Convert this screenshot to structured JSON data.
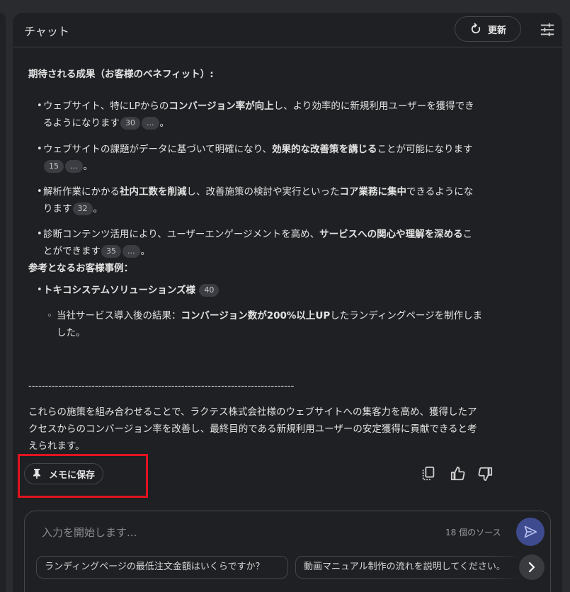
{
  "header": {
    "title": "チャット",
    "refresh_label": "更新"
  },
  "content": {
    "benefits_heading": "期待される成果（お客様のベネフィット）:",
    "bullets": [
      {
        "lines": [
          [
            "ウェブサイト、特にLPからの",
            {
              "b": "コンバージョン率が向上"
            },
            "し、より効率的に新規利用ユーザーを獲得でき"
          ],
          [
            "るようになります",
            {
              "pill": "30"
            },
            {
              "pill": "..."
            },
            "。"
          ]
        ]
      },
      {
        "lines": [
          [
            "ウェブサイトの課題がデータに基づいて明確になり、",
            {
              "b": "効果的な改善策を講じる"
            },
            "ことが可能になります"
          ],
          [
            {
              "pill": "15"
            },
            {
              "pill": "..."
            },
            "。"
          ]
        ]
      },
      {
        "lines": [
          [
            "解析作業にかかる",
            {
              "b": "社内工数を削減"
            },
            "し、改善施策の検討や実行といった",
            {
              "b": "コア業務に集中"
            },
            "できるようにな"
          ],
          [
            "ります",
            {
              "pill": "32"
            },
            "。"
          ]
        ]
      },
      {
        "lines": [
          [
            "診断コンテンツ活用により、ユーザーエンゲージメントを高め、",
            {
              "b": "サービスへの関心や理解を深める"
            },
            "こ"
          ],
          [
            "とができます",
            {
              "pill": "35"
            },
            {
              "pill": "..."
            },
            "。"
          ]
        ]
      }
    ],
    "case_heading": "参考となるお客様事例：",
    "case_company": "トキコシステムソリューションズ様",
    "case_company_pill": "40",
    "case_result_lines": [
      [
        "当社サービス導入後の結果：",
        {
          "b": "コンバージョン数が200%以上UP"
        },
        "したランディングページを制作しま"
      ],
      [
        "した。"
      ]
    ],
    "divider": "--------------------------------------------------------------------------------",
    "conclusion_lines": [
      "これらの施策を組み合わせることで、ラクテス株式会社様のウェブサイトへの集客力を高め、獲得したア",
      "クセスからのコンバージョン率を改善し、最終目的である新規利用ユーザーの安定獲得に貢献できると考",
      "えられます。"
    ]
  },
  "actions": {
    "save_memo_label": "メモに保存",
    "copy_icon": "copy-icon",
    "thumbs_up_icon": "thumbs-up-icon",
    "thumbs_down_icon": "thumbs-down-icon"
  },
  "input": {
    "placeholder": "入力を開始します...",
    "sources_count": "18 個のソース",
    "suggestions": [
      "ランディングページの最低注文金額はいくらですか？",
      "動画マニュアル制作の流れを説明してください。"
    ]
  },
  "colors": {
    "highlight_box": "#e0141e",
    "send_button": "#3e4b8f",
    "background": "#1f2023"
  }
}
